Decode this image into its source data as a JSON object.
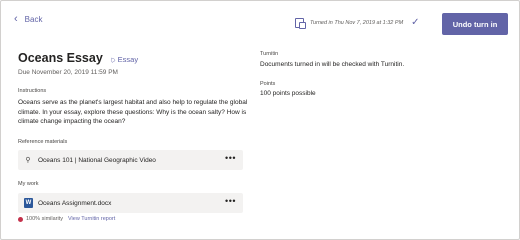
{
  "header": {
    "back_label": "Back",
    "turned_in_status": "Turned in Thu Nov 7, 2019 at 1:32 PM",
    "undo_button_label": "Undo turn in"
  },
  "assignment": {
    "title": "Oceans Essay",
    "category": "Essay",
    "due": "Due November 20, 2019 11:59 PM",
    "instructions_label": "Instructions",
    "instructions_text": "Oceans serve as the planet's largest habitat and also help to regulate the global climate. In your essay, explore these questions: Why is the ocean salty? How is climate change impacting the ocean?",
    "reference_label": "Reference materials",
    "reference_item": "Oceans 101 | National Geographic Video",
    "my_work_label": "My work",
    "work_file": "Oceans Assignment.docx",
    "similarity_text": "100% similarity",
    "report_link": "View Turnitin report"
  },
  "sidebar": {
    "turnitin_label": "Turnitin",
    "turnitin_text": "Documents turned in will be checked with Turnitin.",
    "points_label": "Points",
    "points_text": "100 points possible"
  },
  "colors": {
    "accent": "#6264a7",
    "word_blue": "#2b579a",
    "similarity_red": "#c4314b",
    "card_bg": "#f3f2f1"
  },
  "icons": {
    "back": "chevron-left-icon",
    "turned_in_doc": "document-icon",
    "turned_in_check": "checkmark-icon",
    "category": "tag-icon",
    "reference": "link-icon",
    "work_file": "word-file-icon",
    "more": "more-options-icon",
    "similarity": "red-dot-icon"
  }
}
